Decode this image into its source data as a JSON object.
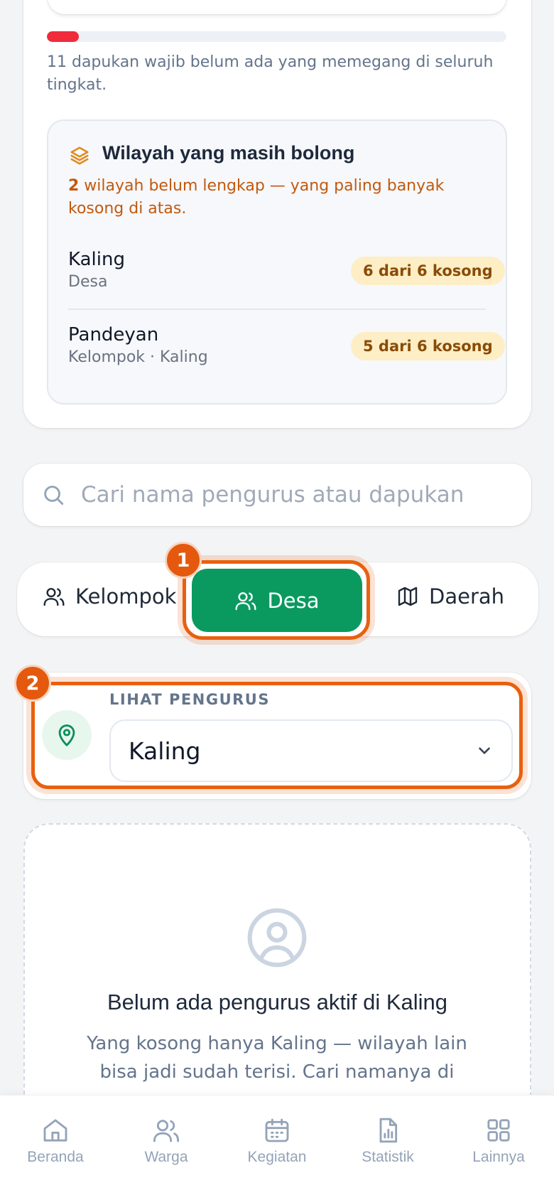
{
  "summary": {
    "progress_percent": 7,
    "note": "11 dapukan wajib belum ada yang memegang di seluruh tingkat."
  },
  "gaps": {
    "title": "Wilayah yang masih bolong",
    "subtitle_count": "2",
    "subtitle_rest": " wilayah belum lengkap — yang paling banyak kosong di atas.",
    "items": [
      {
        "name": "Kaling",
        "kind": "Desa",
        "badge": "6 dari 6 kosong"
      },
      {
        "name": "Pandeyan",
        "kind": "Kelompok · Kaling",
        "badge": "5 dari 6 kosong"
      }
    ]
  },
  "search": {
    "placeholder": "Cari nama pengurus atau dapukan..",
    "value": ""
  },
  "tabs": {
    "items": [
      {
        "label": "Kelompok",
        "icon": "users-icon"
      },
      {
        "label": "Desa",
        "icon": "users-icon"
      },
      {
        "label": "Daerah",
        "icon": "map-icon"
      }
    ],
    "active": "Desa"
  },
  "markers": {
    "one": "1",
    "two": "2"
  },
  "location": {
    "label": "LIHAT PENGURUS",
    "value": "Kaling"
  },
  "empty": {
    "title": "Belum ada pengurus aktif di Kaling",
    "description": "Yang kosong hanya Kaling — wilayah lain bisa jadi sudah terisi. Cari namanya di"
  },
  "nav": {
    "items": [
      {
        "label": "Beranda",
        "icon": "home-icon"
      },
      {
        "label": "Warga",
        "icon": "users-icon"
      },
      {
        "label": "Kegiatan",
        "icon": "calendar-icon"
      },
      {
        "label": "Statistik",
        "icon": "report-chart-icon"
      },
      {
        "label": "Lainnya",
        "icon": "grid-icon"
      }
    ]
  },
  "colors": {
    "accent_green": "#0a9a60",
    "highlight_orange": "#e8600f",
    "progress_red": "#ef2b3c",
    "warning_text": "#c2590f",
    "badge_bg": "#fdeec5"
  }
}
